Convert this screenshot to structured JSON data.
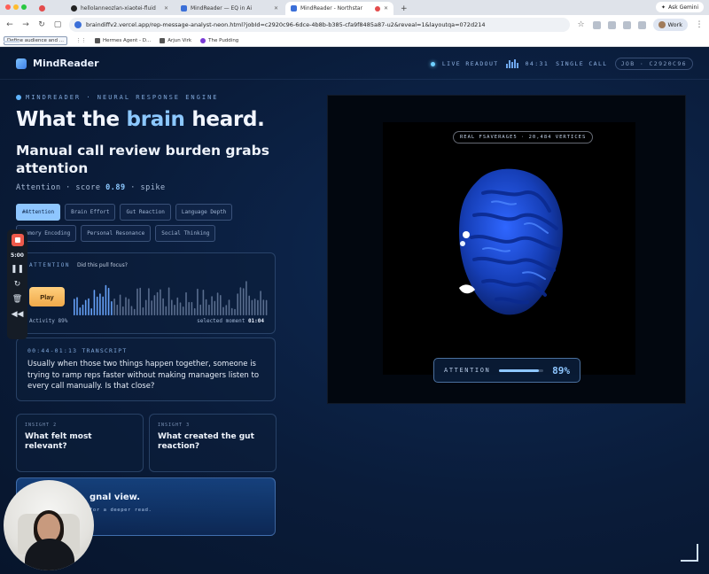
{
  "browser": {
    "tabs": [
      {
        "label": "",
        "active": false
      },
      {
        "label": "hellolanneozlan-xiaotei-fluid",
        "active": false
      },
      {
        "label": "MindReader — EQ in Ai",
        "active": false
      },
      {
        "label": "MindReader - Northstar",
        "active": true
      }
    ],
    "new_tab": "+",
    "gemini_label": "Ask Gemini",
    "url": "braindiffv2.vercel.app/rep-message-analyst-neon.html?jobId=c2920c96-6dce-4b8b-b385-cfa9f8485a87-u2&reveal=1&layoutqa=072d214",
    "profile_label": "Work",
    "bookmarks": [
      {
        "label": "Define audience and ..."
      },
      {
        "label": "Hermes Agent - D..."
      },
      {
        "label": "Arjun Virk"
      },
      {
        "label": "The Pudding"
      }
    ]
  },
  "app": {
    "brand": "MindReader",
    "live_label": "LIVE READOUT",
    "time": "04:31",
    "call_type": "SINGLE CALL",
    "job_id": "JOB · C2920C96"
  },
  "left": {
    "eyebrow": "MINDREADER · NEURAL RESPONSE ENGINE",
    "hero_pre": "What the ",
    "hero_accent": "brain",
    "hero_post": " heard.",
    "headline": "Manual call review burden grabs attention",
    "metric_label": "Attention · score",
    "metric_score": "0.89",
    "metric_suffix": "· spike",
    "chips": [
      {
        "label": "#Attention",
        "active": true
      },
      {
        "label": "Brain Effort",
        "active": false
      },
      {
        "label": "Gut Reaction",
        "active": false
      },
      {
        "label": "Language Depth",
        "active": false
      },
      {
        "label": "Memory Encoding",
        "active": false
      },
      {
        "label": "Personal Resonance",
        "active": false
      },
      {
        "label": "Social Thinking",
        "active": false
      }
    ],
    "player": {
      "label": "ATTENTION",
      "question": "Did this pull focus?",
      "play_label": "Play",
      "activity_label": "Activity 89%",
      "selected_label": "selected moment",
      "selected_time": "01:04"
    },
    "transcript": {
      "label": "00:44-01:13 TRANSCRIPT",
      "text": "Usually when those two things happen together, someone is trying to ramp reps faster without making managers listen to every call manually. Is that close?"
    },
    "insights": [
      {
        "label": "INSIGHT 2",
        "question": "What felt most relevant?"
      },
      {
        "label": "INSIGHT 3",
        "question": "What created the gut reaction?"
      }
    ],
    "signal": {
      "title": "gnal view.",
      "subtitle": "for a deeper read."
    }
  },
  "panel": {
    "vertices_label": "REAL FSAVERAGE5 · 20,484 VERTICES",
    "attention_label": "ATTENTION",
    "attention_value": "89%",
    "attention_fraction": 0.89
  },
  "recorder": {
    "time": "5:00"
  }
}
